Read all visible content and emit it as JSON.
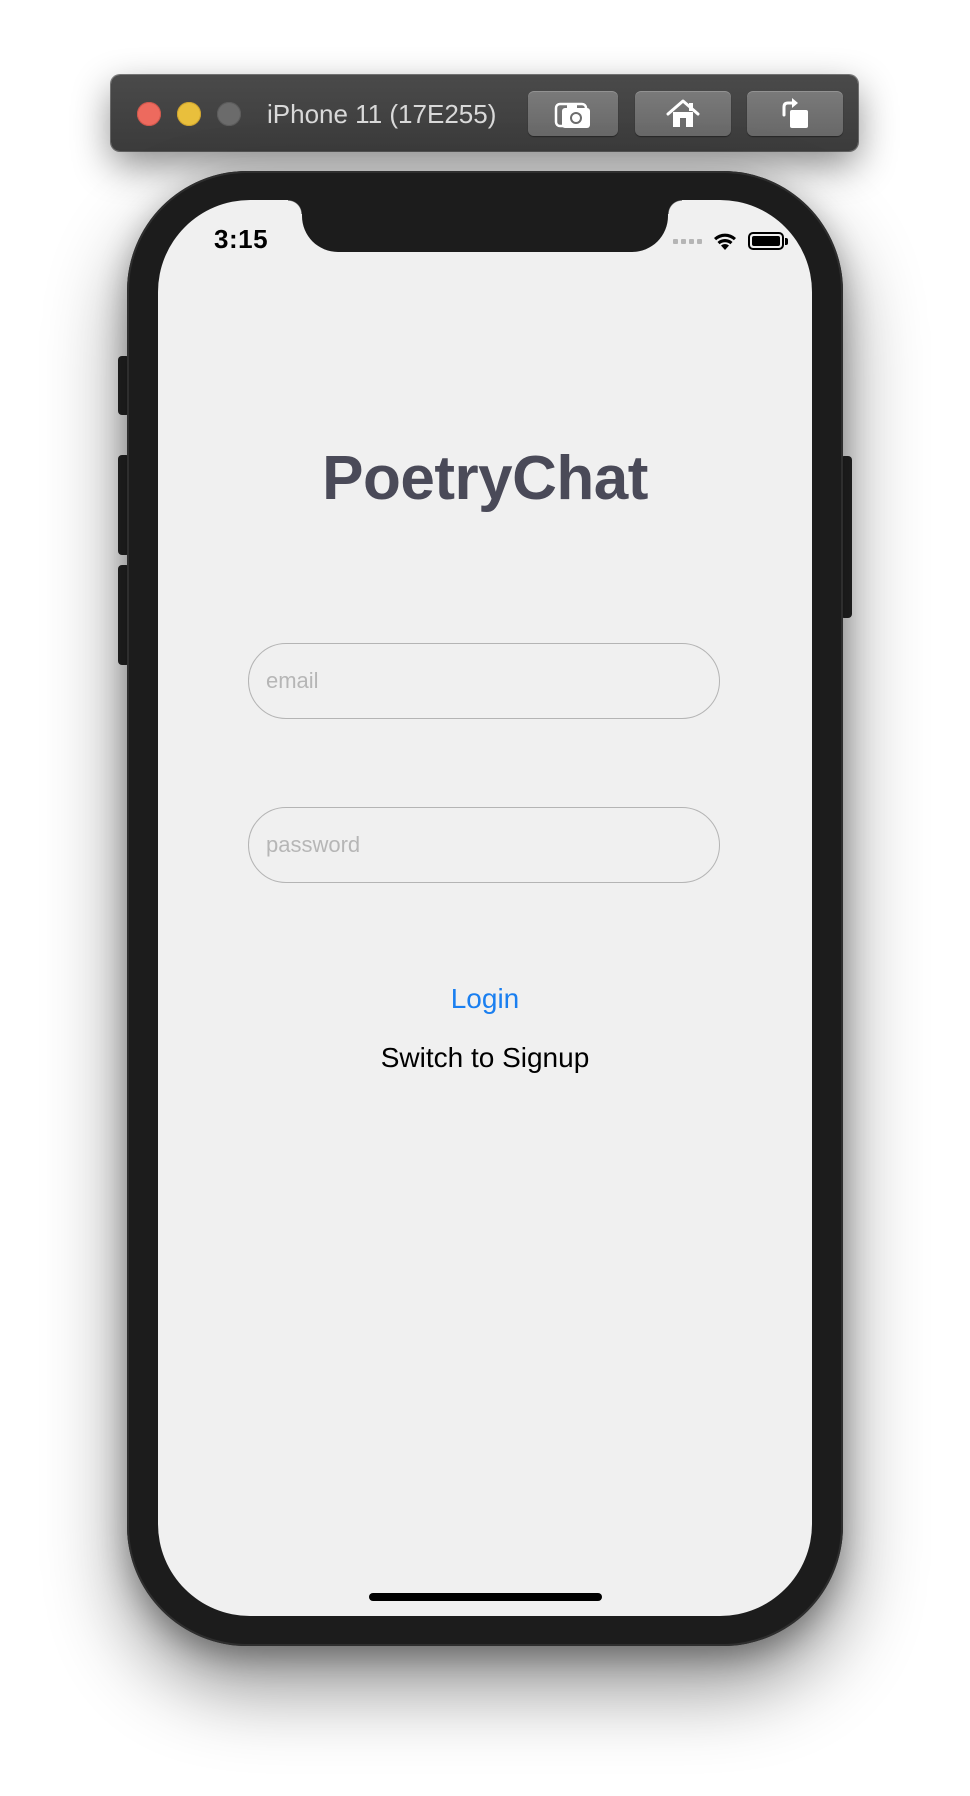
{
  "window": {
    "device_title": "iPhone 11 (17E255)",
    "buttons": [
      {
        "name": "screenshot",
        "icon": "camera-icon"
      },
      {
        "name": "home",
        "icon": "home-icon"
      },
      {
        "name": "rotate",
        "icon": "rotate-icon"
      }
    ],
    "traffic_light_colors": {
      "close": "#ed6a5e",
      "minimize": "#e9bf3c",
      "zoom": "#6b6b6b"
    }
  },
  "status_bar": {
    "time": "3:15",
    "battery_level": 1.0,
    "wifi": true
  },
  "app": {
    "title": "PoetryChat",
    "email_placeholder": "email",
    "email_value": "",
    "password_placeholder": "password",
    "password_value": "",
    "login_label": "Login",
    "switch_label": "Switch to Signup"
  },
  "colors": {
    "title": "#4a4a58",
    "accent": "#1a7ff0",
    "screen_background": "#f0f0f0",
    "field_border": "#b4b4b4"
  }
}
